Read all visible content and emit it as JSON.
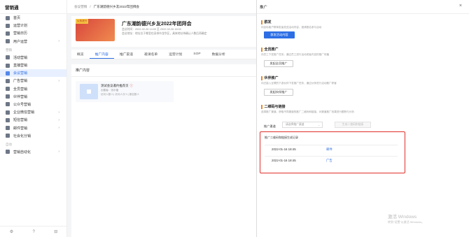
{
  "app": {
    "title": "营销通"
  },
  "sidebar": {
    "items": [
      {
        "label": "首页",
        "chev": false,
        "active": false
      },
      {
        "label": "运营计划",
        "chev": false,
        "active": false
      },
      {
        "label": "营销日历",
        "chev": false,
        "active": false
      },
      {
        "label": "用户运营",
        "chev": true,
        "active": false
      }
    ],
    "section": "营销",
    "items2": [
      {
        "label": "活动营销",
        "chev": false,
        "active": false
      },
      {
        "label": "直播营销",
        "chev": false,
        "active": false
      },
      {
        "label": "会议营销",
        "chev": false,
        "active": true
      },
      {
        "label": "广告营销",
        "chev": true,
        "active": false
      },
      {
        "label": "全员营销",
        "chev": false,
        "active": false
      },
      {
        "label": "伙伴营销",
        "chev": false,
        "active": false
      },
      {
        "label": "公众号营销",
        "chev": false,
        "active": false
      },
      {
        "label": "企业微信营销",
        "chev": true,
        "active": false
      },
      {
        "label": "短信营销",
        "chev": true,
        "active": false
      },
      {
        "label": "邮件营销",
        "chev": true,
        "active": false
      },
      {
        "label": "社会化分销",
        "chev": false,
        "active": false
      }
    ],
    "section2": "自动",
    "items3": [
      {
        "label": "营销自动化",
        "chev": true,
        "active": false
      }
    ]
  },
  "breadcrumb": {
    "parent": "会议营销",
    "separator": "/",
    "current": "广东潮韵德兴乡友2022年团拜会"
  },
  "event": {
    "poster_tag": "火热进行",
    "title": "广东潮韵德兴乡友2022年团拜会",
    "time": "会议时间：2022-02-26 14:00 至 2022-02-26 18:00",
    "location": "会议地址：地址位于哪里在深圳市龙华区，具体地址待确认人数后再确定"
  },
  "tabs": [
    "概览",
    "推广内容",
    "推广渠道",
    "邀请名单",
    "运营计划",
    "SOP",
    "数据分析"
  ],
  "active_tab": "推广内容",
  "panel": {
    "title": "推广内容",
    "item": {
      "title": "测试会议邀约推荐页",
      "creator": "创建者：张乐福",
      "stats": "访问人数 0 | 访问人次 0 | 报名数 0"
    }
  },
  "drawer": {
    "title": "推广",
    "close": "×",
    "sections": [
      {
        "title": "群发",
        "desc": "向目标客户群体批量发送活动内容，邀请报名参与活动",
        "button": "群发活动内容"
      },
      {
        "title": "全员推广",
        "desc": "向员工下发推广任务，通过员工进行活动或者内容的推广传播",
        "button": "发起全员推广"
      },
      {
        "title": "伙伴推广",
        "desc": "向已接入互联的下游伙伴下发推广任务，通过伙伴进行活动推广获客",
        "button": "发起伙伴推广"
      },
      {
        "title": "二维码与链接",
        "desc": "选择推广渠道，获取不同渠道的推广二维码和链接，对渠道推广效果进行跟踪与分析"
      }
    ],
    "channel_label": "推广渠道",
    "channel_placeholder": "请选择推广渠道",
    "generate_button": "生成二维码和链接",
    "records_title": "推广二维码和链接生成记录",
    "records": [
      {
        "time": "2022-01-16 18:45",
        "channel": "邮件"
      },
      {
        "time": "2022-01-16 18:45",
        "channel": "广告"
      }
    ]
  },
  "watermark": {
    "line1": "激活 Windows",
    "line2": "转到“设置”以激活 Windows。"
  },
  "footer_icons": [
    "settings-icon",
    "help-icon",
    "layout-icon"
  ]
}
